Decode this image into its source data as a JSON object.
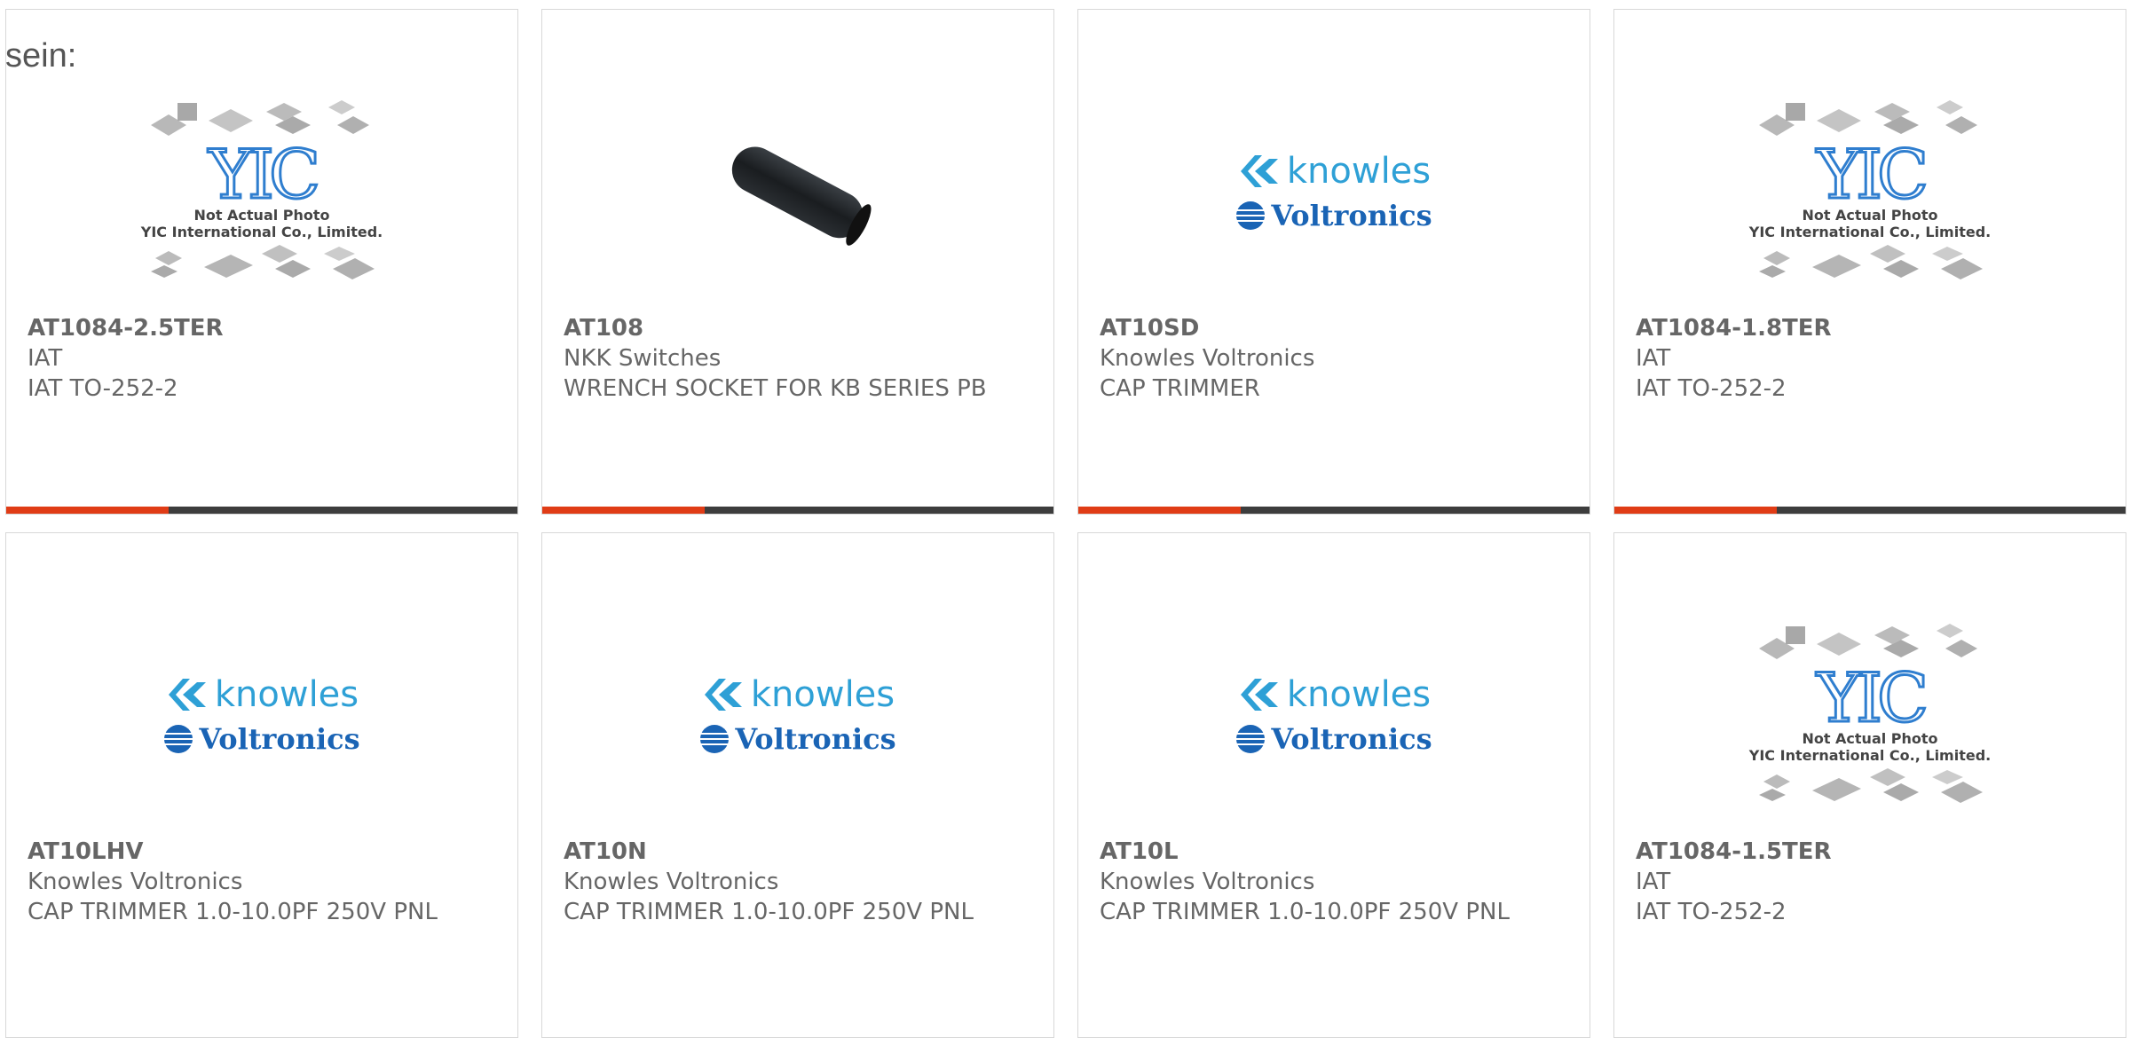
{
  "page_label": "sein:",
  "colors": {
    "accent_red": "#e03c16",
    "accent_dark": "#3d3d3d",
    "knowles_blue": "#2ea0d6",
    "voltronics_blue": "#1a64b5",
    "yic_blue": "#2f7ecf"
  },
  "logo_text": {
    "knowles": "knowles",
    "voltronics": "Voltronics",
    "yic_mark": "YIC",
    "yic_caption_1": "Not Actual Photo",
    "yic_caption_2": "YIC International Co., Limited."
  },
  "products": [
    {
      "part_number": "AT1084-2.5TER",
      "manufacturer": "IAT",
      "description": "IAT TO-252-2",
      "image": "yic-placeholder"
    },
    {
      "part_number": "AT108",
      "manufacturer": "NKK Switches",
      "description": "WRENCH SOCKET FOR KB SERIES PB",
      "image": "black-tube-photo"
    },
    {
      "part_number": "AT10SD",
      "manufacturer": "Knowles Voltronics",
      "description": "CAP TRIMMER",
      "image": "knowles-logo"
    },
    {
      "part_number": "AT1084-1.8TER",
      "manufacturer": "IAT",
      "description": "IAT TO-252-2",
      "image": "yic-placeholder"
    },
    {
      "part_number": "AT10LHV",
      "manufacturer": "Knowles Voltronics",
      "description": "CAP TRIMMER 1.0-10.0PF 250V PNL",
      "image": "knowles-logo"
    },
    {
      "part_number": "AT10N",
      "manufacturer": "Knowles Voltronics",
      "description": "CAP TRIMMER 1.0-10.0PF 250V PNL",
      "image": "knowles-logo"
    },
    {
      "part_number": "AT10L",
      "manufacturer": "Knowles Voltronics",
      "description": "CAP TRIMMER 1.0-10.0PF 250V PNL",
      "image": "knowles-logo"
    },
    {
      "part_number": "AT1084-1.5TER",
      "manufacturer": "IAT",
      "description": "IAT TO-252-2",
      "image": "yic-placeholder"
    }
  ]
}
